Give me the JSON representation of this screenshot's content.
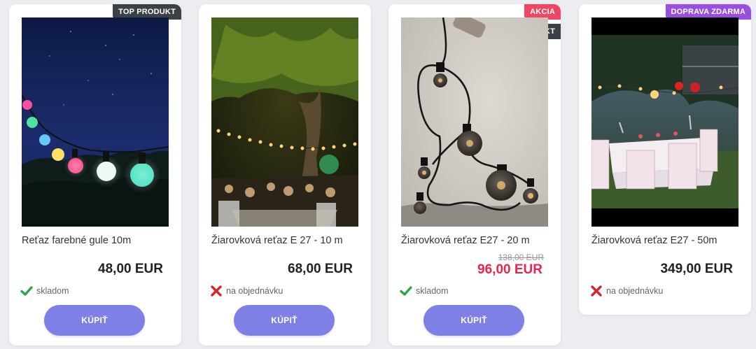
{
  "buy_label": "KÚPIŤ",
  "colors": {
    "buy_button": "#7f80e6",
    "badge_dark": "#3c4047",
    "badge_sale": "#ee4663",
    "badge_shipping": "#9a4ee0",
    "sale_price": "#e8244f",
    "in_stock_check": "#22a744",
    "on_order_x": "#d9232f"
  },
  "products": [
    {
      "badges": [
        "TOP PRODUKT"
      ],
      "image": "colorful-globe-light-string-night",
      "name": "Reťaz farebné gule 10m",
      "price": "48,00 EUR",
      "stock_icon": "check-icon",
      "stock": "skladom"
    },
    {
      "badges": [],
      "image": "garden-party-string-lights-tree",
      "name": "Žiarovková reťaz E 27 - 10 m",
      "price": "68,00 EUR",
      "stock_icon": "x-icon",
      "stock": "na objednávku"
    },
    {
      "badges": [
        "AKCIA",
        "TOP PRODUKT"
      ],
      "image": "edison-bulbs-on-concrete",
      "name": "Žiarovková reťaz E27 - 20 m",
      "old_price": "138,00 EUR",
      "price": "96,00 EUR",
      "stock_icon": "check-icon",
      "stock": "skladom"
    },
    {
      "badges": [
        "DOPRAVA ZDARMA"
      ],
      "image": "garden-dinner-table-lights",
      "name": "Žiarovková reťaz E27 - 50m",
      "price": "349,00 EUR",
      "stock_icon": "x-icon",
      "stock": "na objednávku"
    }
  ]
}
